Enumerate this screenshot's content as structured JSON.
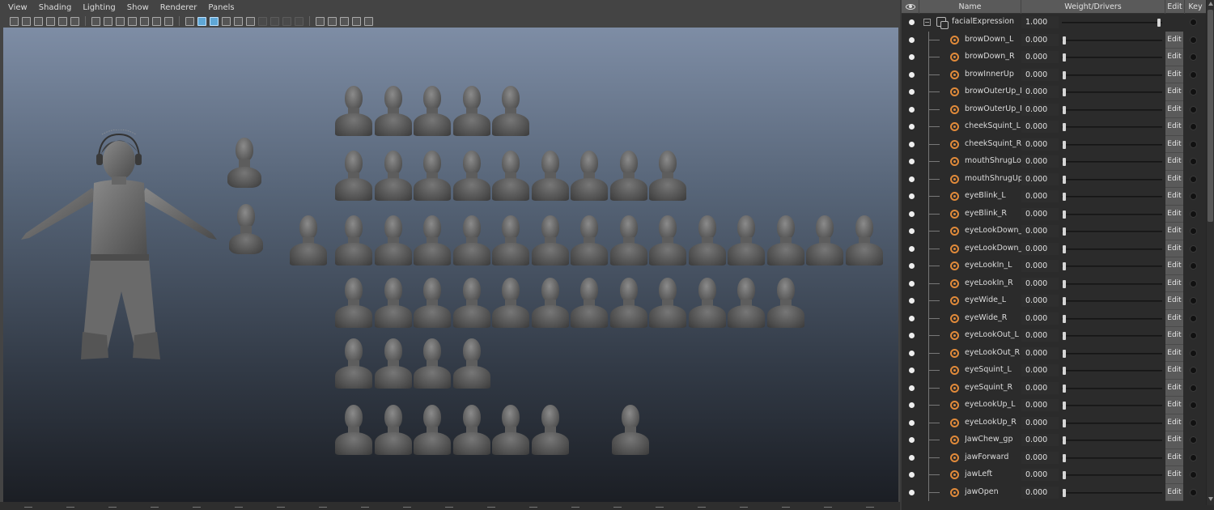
{
  "viewport": {
    "menu": [
      "View",
      "Shading",
      "Lighting",
      "Show",
      "Renderer",
      "Panels"
    ],
    "toolbar_icons": [
      "camera-icon",
      "select-camera-icon",
      "lock-camera-icon",
      "bookmark-icon",
      "image-plane-icon",
      "grease-pencil-icon",
      "grid-icon",
      "film-gate-icon",
      "resolution-gate-icon",
      "gate-mask-icon",
      "field-chart-icon",
      "safe-action-icon",
      "safe-title-icon",
      "wireframe-icon",
      "smooth-shade-icon",
      "wireframe-on-shaded-icon",
      "textured-icon",
      "lights-icon",
      "shadows-icon",
      "ambient-occlusion-icon",
      "motion-blur-icon",
      "anti-alias-icon",
      "depth-of-field-icon",
      "isolate-select-icon",
      "xray-icon",
      "xray-joints-icon",
      "xray-active-icon",
      "backface-icon"
    ]
  },
  "shape_editor": {
    "columns": {
      "name": "Name",
      "weight": "Weight/Drivers",
      "edit": "Edit",
      "key": "Key"
    },
    "group": {
      "name": "facialExpression",
      "weight": "1.000"
    },
    "edit_label": "Edit",
    "targets": [
      {
        "name": "browDown_L",
        "weight": "0.000"
      },
      {
        "name": "browDown_R",
        "weight": "0.000"
      },
      {
        "name": "browInnerUp",
        "weight": "0.000"
      },
      {
        "name": "browOuterUp_L",
        "weight": "0.000"
      },
      {
        "name": "browOuterUp_R",
        "weight": "0.000"
      },
      {
        "name": "cheekSquint_L",
        "weight": "0.000"
      },
      {
        "name": "cheekSquint_R",
        "weight": "0.000"
      },
      {
        "name": "mouthShrugLow",
        "weight": "0.000"
      },
      {
        "name": "mouthShrugUpp",
        "weight": "0.000"
      },
      {
        "name": "eyeBlink_L",
        "weight": "0.000"
      },
      {
        "name": "eyeBlink_R",
        "weight": "0.000"
      },
      {
        "name": "eyeLookDown_L",
        "weight": "0.000"
      },
      {
        "name": "eyeLookDown_R",
        "weight": "0.000"
      },
      {
        "name": "eyeLookIn_L",
        "weight": "0.000"
      },
      {
        "name": "eyeLookIn_R",
        "weight": "0.000"
      },
      {
        "name": "eyeWide_L",
        "weight": "0.000"
      },
      {
        "name": "eyeWide_R",
        "weight": "0.000"
      },
      {
        "name": "eyeLookOut_L",
        "weight": "0.000"
      },
      {
        "name": "eyeLookOut_R",
        "weight": "0.000"
      },
      {
        "name": "eyeSquint_L",
        "weight": "0.000"
      },
      {
        "name": "eyeSquint_R",
        "weight": "0.000"
      },
      {
        "name": "eyeLookUp_L",
        "weight": "0.000"
      },
      {
        "name": "eyeLookUp_R",
        "weight": "0.000"
      },
      {
        "name": "JawChew_gp",
        "weight": "0.000"
      },
      {
        "name": "jawForward",
        "weight": "0.000"
      },
      {
        "name": "jawLeft",
        "weight": "0.000"
      },
      {
        "name": "jawOpen",
        "weight": "0.000"
      }
    ]
  }
}
